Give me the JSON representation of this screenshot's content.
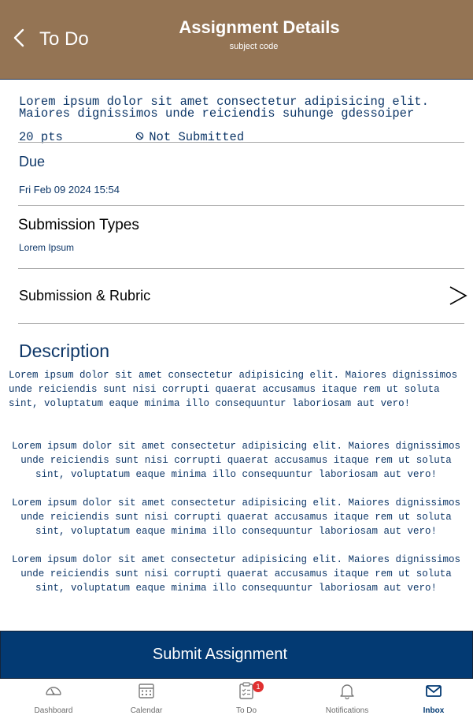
{
  "header": {
    "back_label": "To Do",
    "title": "Assignment Details",
    "subtitle": "subject code"
  },
  "assignment": {
    "title_line1": "Lorem ipsum dolor sit amet consectetur adipisicing elit.",
    "title_line2": "Maiores dignissimos unde reiciendis suhunge gdessoiper",
    "points": "20 pts",
    "status": "Not Submitted"
  },
  "due": {
    "heading": "Due",
    "value": "Fri Feb 09 2024 15:54"
  },
  "submission_types": {
    "heading": "Submission Types",
    "value": "Lorem Ipsum"
  },
  "rubric": {
    "label": "Submission & Rubric"
  },
  "description": {
    "heading": "Description",
    "paragraphs": [
      "Lorem ipsum dolor sit amet consectetur adipisicing elit. Maiores dignissimos unde reiciendis sunt nisi corrupti quaerat accusamus itaque rem ut soluta sint, voluptatum eaque minima illo consequuntur laboriosam aut vero!",
      "Lorem ipsum dolor sit amet consectetur adipisicing elit. Maiores dignissimos unde reiciendis sunt nisi corrupti quaerat accusamus itaque rem ut soluta sint, voluptatum eaque minima illo consequuntur laboriosam aut vero!",
      "Lorem ipsum dolor sit amet consectetur adipisicing elit. Maiores dignissimos unde reiciendis sunt nisi corrupti quaerat accusamus itaque rem ut soluta sint, voluptatum eaque minima illo consequuntur laboriosam aut vero!",
      "Lorem ipsum dolor sit amet consectetur adipisicing elit. Maiores dignissimos unde reiciendis sunt nisi corrupti quaerat accusamus itaque rem ut soluta sint, voluptatum eaque minima illo consequuntur laboriosam aut vero!"
    ]
  },
  "submit": {
    "label": "Submit Assignment"
  },
  "tabbar": {
    "items": [
      {
        "label": "Dashboard",
        "icon": "dashboard-icon"
      },
      {
        "label": "Calendar",
        "icon": "calendar-icon"
      },
      {
        "label": "To Do",
        "icon": "todo-icon",
        "badge": "1"
      },
      {
        "label": "Notifications",
        "icon": "bell-icon"
      },
      {
        "label": "Inbox",
        "icon": "mail-icon",
        "active": true
      }
    ]
  },
  "colors": {
    "header_bg": "#947454",
    "navy": "#033a73",
    "text_navy": "#0e3768",
    "badge_red": "#e03030"
  }
}
